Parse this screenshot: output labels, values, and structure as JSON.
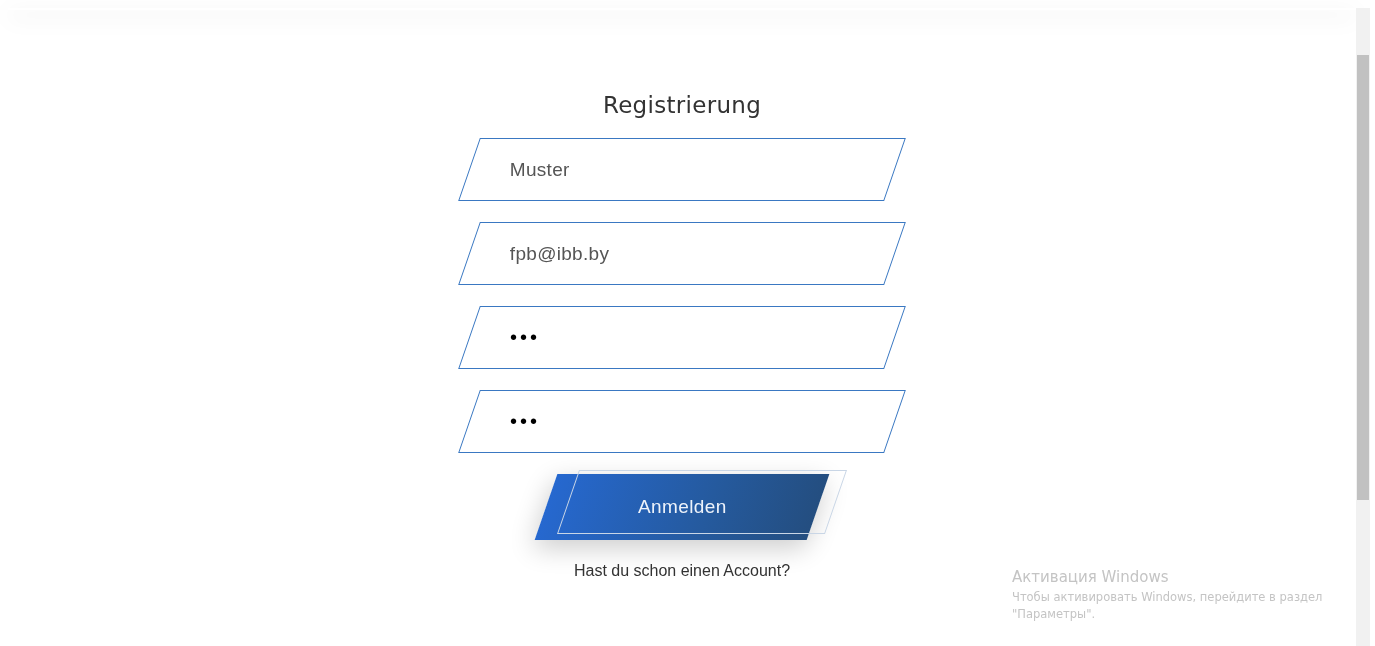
{
  "title": "Registrierung",
  "fields": [
    {
      "kind": "text",
      "value": "Muster"
    },
    {
      "kind": "text",
      "value": "fpb@ibb.by"
    },
    {
      "kind": "password",
      "value": "•••"
    },
    {
      "kind": "password",
      "value": "•••"
    }
  ],
  "submit_button": "Anmelden",
  "account_link": "Hast du schon einen Account?",
  "os_notice": {
    "title": "Активация Windows",
    "text": "Чтобы активировать Windows, перейдите в раздел \"Параметры\"."
  }
}
